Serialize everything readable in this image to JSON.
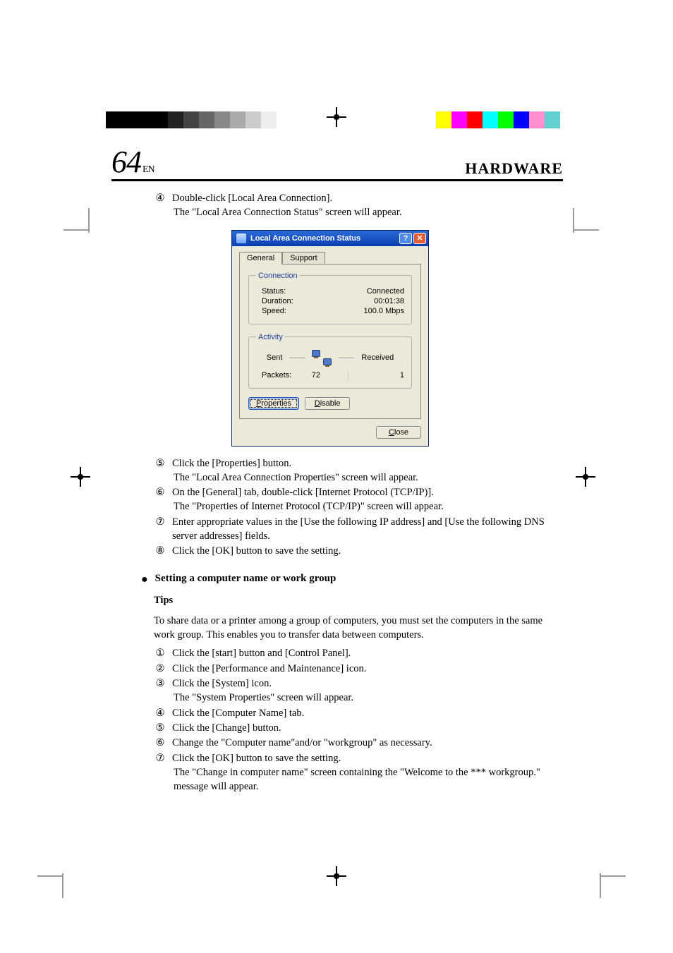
{
  "page": {
    "number": "64",
    "lang_suffix": "EN",
    "section_title": "HARDWARE"
  },
  "top_steps": {
    "items": [
      {
        "num": "④",
        "text": "Double-click [Local Area Connection].",
        "cont": "The \"Local Area Connection Status\" screen will appear."
      }
    ]
  },
  "dialog": {
    "title": "Local Area Connection Status",
    "help_btn": "?",
    "close_btn": "✕",
    "tabs": {
      "general": "General",
      "support": "Support"
    },
    "groups": {
      "connection": {
        "legend": "Connection",
        "rows": [
          {
            "label": "Status:",
            "value": "Connected"
          },
          {
            "label": "Duration:",
            "value": "00:01:38"
          },
          {
            "label": "Speed:",
            "value": "100.0 Mbps"
          }
        ]
      },
      "activity": {
        "legend": "Activity",
        "sent_label": "Sent",
        "received_label": "Received",
        "packets_label": "Packets:",
        "sent_value": "72",
        "received_value": "1"
      }
    },
    "buttons": {
      "properties": "Properties",
      "disable": "Disable",
      "close": "Close"
    }
  },
  "mid_steps": {
    "items": [
      {
        "num": "⑤",
        "text": "Click the [Properties] button.",
        "cont": "The \"Local Area Connection Properties\" screen will appear."
      },
      {
        "num": "⑥",
        "text": "On the [General] tab, double-click [Internet Protocol (TCP/IP)].",
        "cont": "The \"Properties of Internet Protocol (TCP/IP)\" screen will appear."
      },
      {
        "num": "⑦",
        "text": "Enter appropriate values in the [Use the following IP address] and [Use the following DNS server addresses] fields."
      },
      {
        "num": "⑧",
        "text": "Click the [OK] button to save the setting."
      }
    ]
  },
  "bullet_heading": "Setting a computer name or work group",
  "tips_label": "Tips",
  "tips_paragraph": "To share data or a printer among a group of computers, you must set the computers in the same work group.  This enables you to transfer data between computers.",
  "bottom_steps": {
    "items": [
      {
        "num": "①",
        "text": "Click the [start] button and [Control Panel]."
      },
      {
        "num": "②",
        "text": "Click the [Performance and Maintenance] icon."
      },
      {
        "num": "③",
        "text": "Click the [System] icon.",
        "cont": "The \"System Properties\" screen will appear."
      },
      {
        "num": "④",
        "text": "Click the [Computer Name] tab."
      },
      {
        "num": "⑤",
        "text": "Click the [Change] button."
      },
      {
        "num": "⑥",
        "text": "Change the \"Computer name\"and/or \"workgroup\" as necessary."
      },
      {
        "num": "⑦",
        "text": "Click the [OK] button to save the setting.",
        "cont": "The \"Change in computer name\" screen containing the \"Welcome to the *** workgroup.\" message will appear."
      }
    ]
  },
  "reg_marks": {
    "bw_steps": [
      "#000",
      "#000",
      "#000",
      "#000",
      "#222",
      "#444",
      "#666",
      "#888",
      "#aaa",
      "#ccc",
      "#eee"
    ],
    "cmyk": [
      "#ffff00",
      "#ff00ff",
      "#ff0000",
      "#00ffff",
      "#00ff00",
      "#0000ff",
      "#ff8fce",
      "#62d0d0"
    ]
  }
}
